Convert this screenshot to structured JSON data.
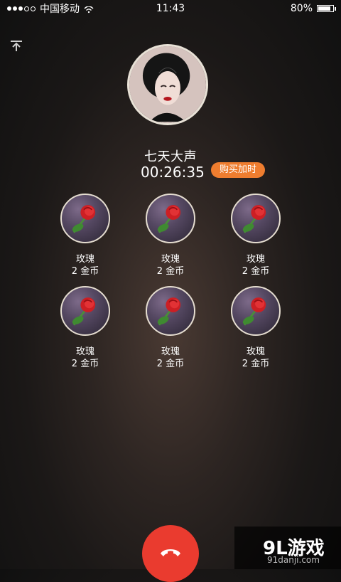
{
  "status_bar": {
    "carrier": "中国移动",
    "time": "11:43",
    "battery": "80%"
  },
  "call": {
    "name": "七天大声",
    "timer": "00:26:35",
    "buy_time": "购买加时"
  },
  "gifts": [
    {
      "label": "玫瑰",
      "price": "2 金币"
    },
    {
      "label": "玫瑰",
      "price": "2 金币"
    },
    {
      "label": "玫瑰",
      "price": "2 金币"
    },
    {
      "label": "玫瑰",
      "price": "2 金币"
    },
    {
      "label": "玫瑰",
      "price": "2 金币"
    },
    {
      "label": "玫瑰",
      "price": "2 金币"
    }
  ],
  "watermark": {
    "brand": "9L游戏",
    "site": "91danji.com"
  },
  "colors": {
    "accent": "#ee7d2f",
    "hangup": "#ea3b2f"
  },
  "icons": {
    "minimize": "minimize-icon",
    "hangup": "phone-hangup-icon",
    "wifi": "wifi-icon",
    "battery": "battery-icon",
    "rose": "rose-icon"
  }
}
